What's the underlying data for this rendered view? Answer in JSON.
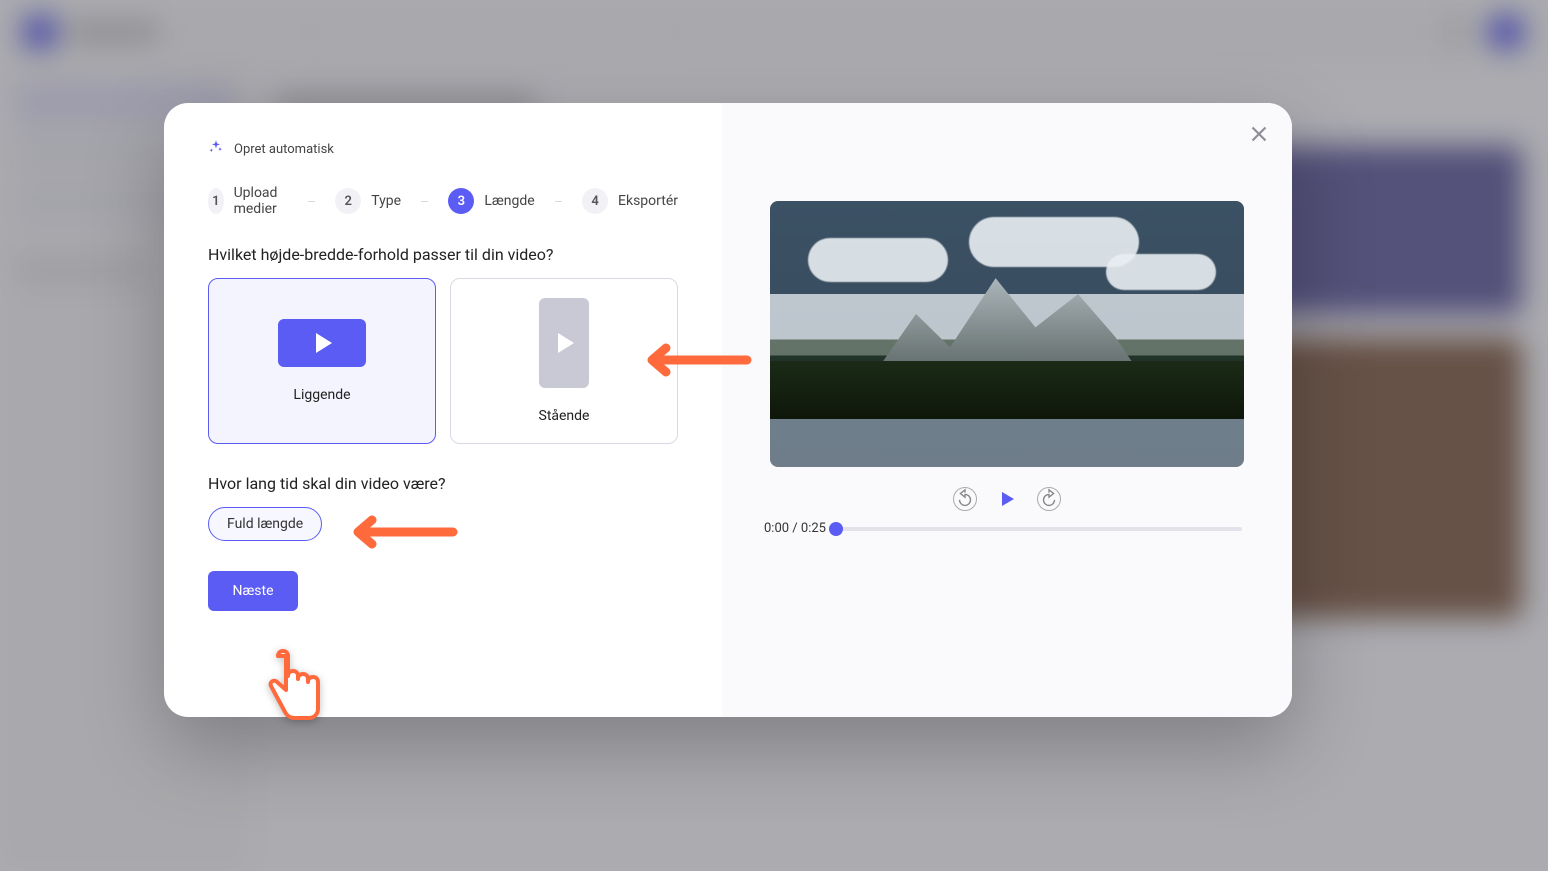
{
  "autoCreateLabel": "Opret automatisk",
  "steps": [
    {
      "num": "1",
      "label": "Upload medier"
    },
    {
      "num": "2",
      "label": "Type"
    },
    {
      "num": "3",
      "label": "Længde"
    },
    {
      "num": "4",
      "label": "Eksportér"
    }
  ],
  "activeStepIndex": 2,
  "q_ratio": "Hvilket højde-bredde-forhold passer til din video?",
  "ratios": [
    {
      "label": "Liggende",
      "selected": true
    },
    {
      "label": "Stående",
      "selected": false
    }
  ],
  "q_length": "Hvor lang tid skal din video være?",
  "lengthPill": "Fuld længde",
  "nextLabel": "Næste",
  "video": {
    "currentTime": "0:00",
    "duration": "0:25"
  }
}
